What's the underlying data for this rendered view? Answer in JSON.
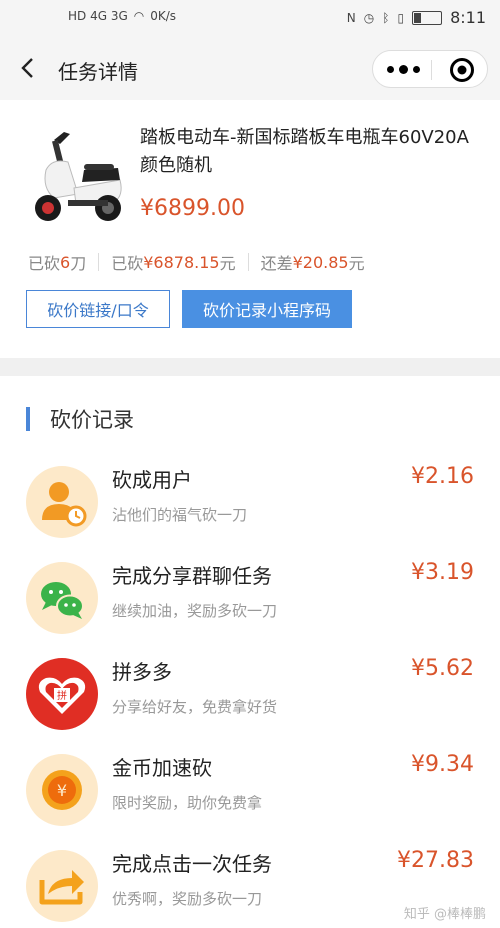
{
  "status_bar": {
    "network_left": "HD 4G 3G",
    "wifi_speed": "0K/s",
    "time": "8:11",
    "battery_level": 0.25
  },
  "nav": {
    "title": "任务详情"
  },
  "product": {
    "title": "踏板电动车-新国标踏板车电瓶车60V20A颜色随机",
    "price": "¥6899.00",
    "stats": {
      "cut_times_label": "已砍",
      "cut_times_value": "6",
      "cut_times_unit": "刀",
      "cut_amount_label": "已砍",
      "cut_amount_value": "¥6878.15",
      "cut_amount_unit": "元",
      "remaining_label": "还差",
      "remaining_value": "¥20.85",
      "remaining_unit": "元"
    },
    "buttons": {
      "link_label": "砍价链接/口令",
      "qrcode_label": "砍价记录小程序码"
    }
  },
  "records": {
    "title": "砍价记录",
    "items": [
      {
        "name": "砍成用户",
        "desc": "沾他们的福气砍一刀",
        "amount": "¥2.16",
        "icon": "user-clock-icon"
      },
      {
        "name": "完成分享群聊任务",
        "desc": "继续加油，奖励多砍一刀",
        "amount": "¥3.19",
        "icon": "wechat-icon"
      },
      {
        "name": "拼多多",
        "desc": "分享给好友，免费拿好货",
        "amount": "¥5.62",
        "icon": "pinduoduo-icon"
      },
      {
        "name": "金币加速砍",
        "desc": "限时奖励，助你免费拿",
        "amount": "¥9.34",
        "icon": "gold-coin-icon"
      },
      {
        "name": "完成点击一次任务",
        "desc": "优秀啊，奖励多砍一刀",
        "amount": "¥27.83",
        "icon": "share-arrow-icon"
      }
    ]
  },
  "watermark": "知乎 @棒棒鹏",
  "colors": {
    "accent_blue": "#4a90e2",
    "price_red": "#d9542b"
  }
}
